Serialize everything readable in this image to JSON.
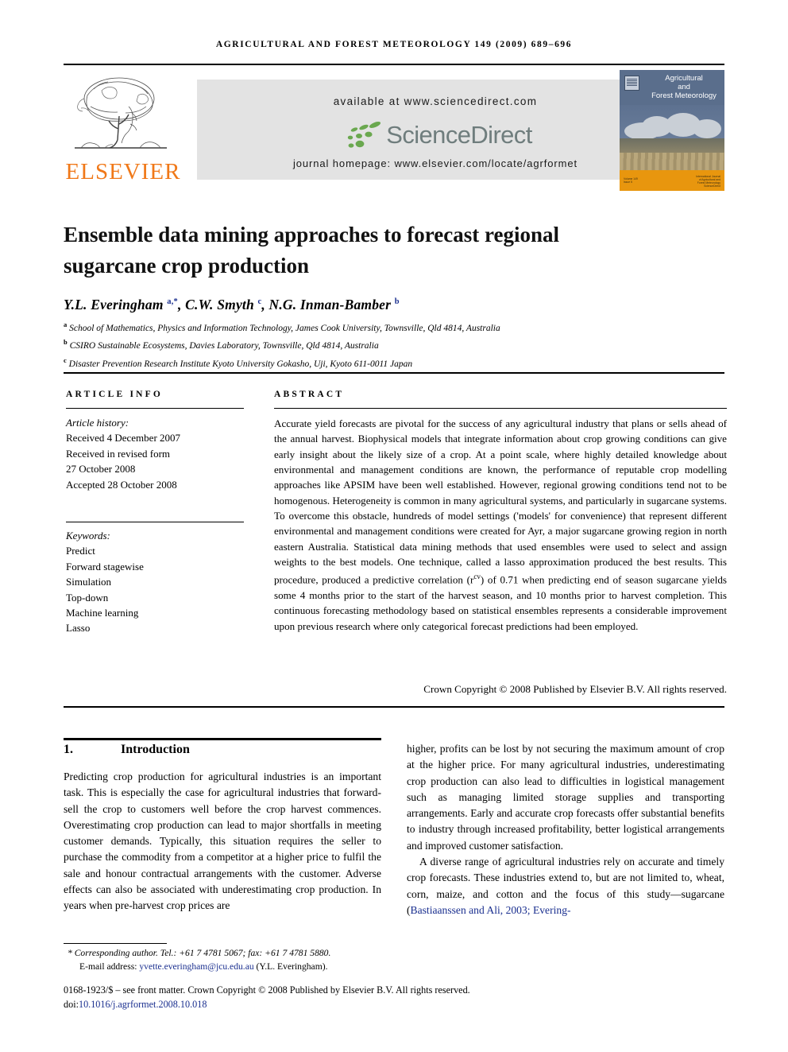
{
  "running_head": "AGRICULTURAL AND FOREST METEOROLOGY 149 (2009) 689–696",
  "masthead": {
    "publisher_name": "ELSEVIER",
    "available_at": "available at www.sciencedirect.com",
    "sciencedirect_word": "ScienceDirect",
    "journal_homepage": "journal homepage: www.elsevier.com/locate/agrformet",
    "cover": {
      "line1": "Agricultural",
      "line2": "and",
      "line3": "Forest Meteorology"
    }
  },
  "article": {
    "title": "Ensemble data mining approaches to forecast regional sugarcane crop production",
    "authors_html": "Y.L. Everingham <sup>a,*</sup>, C.W. Smyth <sup>c</sup>, N.G. Inman-Bamber <sup>b</sup>",
    "affiliations": [
      "School of Mathematics, Physics and Information Technology, James Cook University, Townsville, Qld 4814, Australia",
      "CSIRO Sustainable Ecosystems, Davies Laboratory, Townsville, Qld 4814, Australia",
      "Disaster Prevention Research Institute Kyoto University Gokasho, Uji, Kyoto 611-0011 Japan"
    ],
    "affiliation_marks": [
      "a",
      "b",
      "c"
    ]
  },
  "info": {
    "label_article_info": "ARTICLE INFO",
    "label_abstract": "ABSTRACT",
    "history_heading": "Article history:",
    "history_lines": [
      "Received 4 December 2007",
      "Received in revised form",
      "27 October 2008",
      "Accepted 28 October 2008"
    ],
    "keywords_heading": "Keywords:",
    "keywords": [
      "Predict",
      "Forward stagewise",
      "Simulation",
      "Top-down",
      "Machine learning",
      "Lasso"
    ]
  },
  "abstract": {
    "part1": "Accurate yield forecasts are pivotal for the success of any agricultural industry that plans or sells ahead of the annual harvest. Biophysical models that integrate information about crop growing conditions can give early insight about the likely size of a crop. At a point scale, where highly detailed knowledge about environmental and management conditions are known, the performance of reputable crop modelling approaches like APSIM have been well established. However, regional growing conditions tend not to be homogenous. Heterogeneity is common in many agricultural systems, and particularly in sugarcane systems. To overcome this obstacle, hundreds of model settings ('models' for convenience) that represent different environmental and management conditions were created for Ayr, a major sugarcane growing region in north eastern Australia. Statistical data mining methods that used ensembles were used to select and assign weights to the best models. One technique, called a lasso approximation produced the best results. This procedure, produced a predictive correlation (r",
    "superscript": "cv",
    "part2": ") of 0.71 when predicting end of season sugarcane yields some 4 months prior to the start of the harvest season, and 10 months prior to harvest completion. This continuous forecasting methodology based on statistical ensembles represents a considerable improvement upon previous research where only categorical forecast predictions had been employed.",
    "copyright": "Crown Copyright © 2008 Published by Elsevier B.V. All rights reserved."
  },
  "body": {
    "section_number": "1.",
    "section_title": "Introduction",
    "left_paragraph": "Predicting crop production for agricultural industries is an important task. This is especially the case for agricultural industries that forward-sell the crop to customers well before the crop harvest commences. Overestimating crop production can lead to major shortfalls in meeting customer demands. Typically, this situation requires the seller to purchase the commodity from a competitor at a higher price to fulfil the sale and honour contractual arrangements with the customer. Adverse effects can also be associated with underestimating crop production. In years when pre-harvest crop prices are",
    "right_paragraph_1": "higher, profits can be lost by not securing the maximum amount of crop at the higher price. For many agricultural industries, underestimating crop production can also lead to difficulties in logistical management such as managing limited storage supplies and transporting arrangements. Early and accurate crop forecasts offer substantial benefits to industry through increased profitability, better logistical arrangements and improved customer satisfaction.",
    "right_paragraph_2_pre": "A diverse range of agricultural industries rely on accurate and timely crop forecasts. These industries extend to, but are not limited to, wheat, corn, maize, and cotton and the focus of this study—sugarcane (",
    "right_paragraph_2_citation": "Bastiaanssen and Ali, 2003; Evering-"
  },
  "footnotes": {
    "corresponding": "* Corresponding author. Tel.: +61 7 4781 5067; fax: +61 7 4781 5880.",
    "email_label": "E-mail address:",
    "email": "yvette.everingham@jcu.edu.au",
    "email_suffix": "(Y.L. Everingham).",
    "front_matter": "0168-1923/$ – see front matter. Crown Copyright © 2008 Published by Elsevier B.V. All rights reserved.",
    "doi_label": "doi:",
    "doi": "10.1016/j.agrformet.2008.10.018"
  },
  "colors": {
    "elsevier_orange": "#F07818",
    "link_blue": "#1a2f8f",
    "sciencedirect_green": "#6aa84f",
    "banner_grey": "#e3e3e3",
    "cover_blue": "#5a6e8c",
    "cover_orange": "#e8960e"
  }
}
